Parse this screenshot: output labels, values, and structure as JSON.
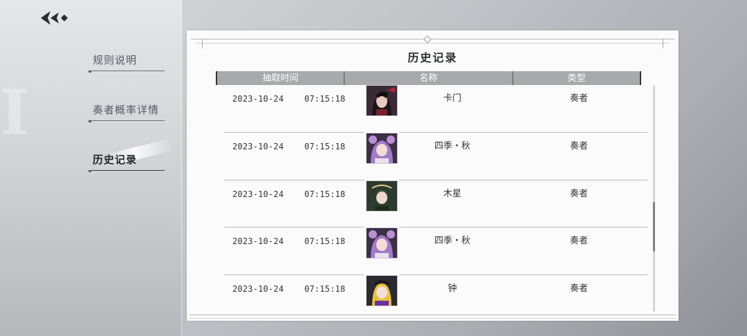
{
  "nav": {
    "items": [
      {
        "label": "规则说明"
      },
      {
        "label": "奏者概率详情"
      },
      {
        "label": "历史记录"
      }
    ],
    "active_index": 2
  },
  "panel": {
    "title": "历史记录",
    "columns": [
      "抽取时间",
      "名称",
      "类型"
    ]
  },
  "rows": [
    {
      "date": "2023-10-24",
      "time": "07:15:18",
      "name": "卡门",
      "type": "奏者",
      "avatar": "character-avatar"
    },
    {
      "date": "2023-10-24",
      "time": "07:15:18",
      "name": "四季・秋",
      "type": "奏者",
      "avatar": "character-avatar"
    },
    {
      "date": "2023-10-24",
      "time": "07:15:18",
      "name": "木星",
      "type": "奏者",
      "avatar": "character-avatar"
    },
    {
      "date": "2023-10-24",
      "time": "07:15:18",
      "name": "四季・秋",
      "type": "奏者",
      "avatar": "character-avatar"
    },
    {
      "date": "2023-10-24",
      "time": "07:15:18",
      "name": "钟",
      "type": "奏者",
      "avatar": "character-avatar"
    }
  ],
  "colors": {
    "header_bg": "#a8a9ab",
    "panel_bg": "#fbfbfb",
    "text": "#333333"
  }
}
